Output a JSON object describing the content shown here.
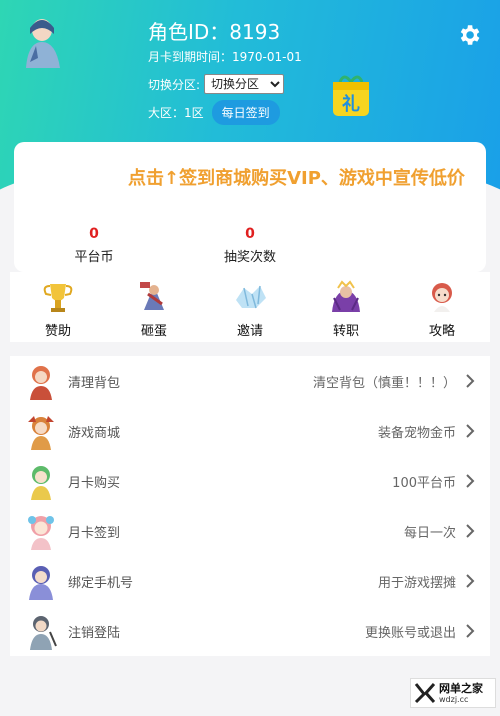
{
  "header": {
    "role_id": "角色ID：8193",
    "monthcard_expiry": "月卡到期时间：1970-01-01",
    "zone_label": "切换分区:",
    "zone_select_value": "切换分区",
    "area_text": "大区：1区",
    "daily_signin": "每日签到",
    "gift_glyph": "礼",
    "icons": {
      "gear": "gear-icon",
      "gift": "gift-icon",
      "avatar": "avatar"
    }
  },
  "notice": {
    "marquee": "点击↑签到商城购买VIP、游戏中宣传低价"
  },
  "stats": [
    {
      "value": "0",
      "label": "平台币"
    },
    {
      "value": "0",
      "label": "抽奖次数"
    }
  ],
  "shortcuts": [
    {
      "label": "赞助",
      "icon": "trophy-icon"
    },
    {
      "label": "砸蛋",
      "icon": "hammer-character-icon"
    },
    {
      "label": "邀请",
      "icon": "crystal-icon"
    },
    {
      "label": "转职",
      "icon": "warrior-icon"
    },
    {
      "label": "攻略",
      "icon": "doll-icon"
    }
  ],
  "menu": [
    {
      "title": "清理背包",
      "value": "清空背包（慎重！！！）"
    },
    {
      "title": "游戏商城",
      "value": "装备宠物金币"
    },
    {
      "title": "月卡购买",
      "value": "100平台币"
    },
    {
      "title": "月卡签到",
      "value": "每日一次"
    },
    {
      "title": "绑定手机号",
      "value": "用于游戏摆摊"
    },
    {
      "title": "注销登陆",
      "value": "更换账号或退出"
    }
  ],
  "watermark": {
    "name": "网单之家",
    "url": "wdzj.cc"
  },
  "colors": {
    "header_start": "#2ed6b4",
    "header_end": "#1aa0e8",
    "accent_red": "#e02020",
    "marquee": "#f0a030"
  }
}
